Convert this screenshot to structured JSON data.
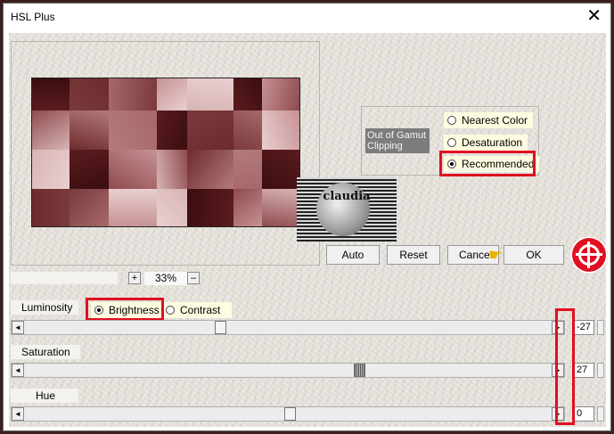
{
  "window": {
    "title": "HSL Plus",
    "close_glyph": "✕"
  },
  "preview": {
    "tile_colors": [
      "#5a1c1f",
      "#7a3a3c",
      "#a7686a",
      "#c69294",
      "#e9cfd0",
      "#3b0d0f",
      "#8f4b4e",
      "#d8b4b5",
      "#6e2a2d",
      "#b27a7c"
    ],
    "watermark_text": "claudia"
  },
  "gamut": {
    "label": "Out of Gamut Clipping",
    "options": [
      {
        "label": "Nearest Color",
        "selected": false
      },
      {
        "label": "Desaturation",
        "selected": false
      },
      {
        "label": "Recommended",
        "selected": true
      }
    ]
  },
  "buttons": {
    "auto": "Auto",
    "reset": "Reset",
    "cancel": "Cancel",
    "ok": "OK"
  },
  "zoom": {
    "plus": "+",
    "minus": "–",
    "value": "33%"
  },
  "luminosity": {
    "label": "Luminosity",
    "mode_options": [
      {
        "label": "Brightness",
        "selected": true
      },
      {
        "label": "Contrast",
        "selected": false
      }
    ],
    "value": "-27"
  },
  "saturation": {
    "label": "Saturation",
    "value": "27"
  },
  "hue": {
    "label": "Hue",
    "value": "0"
  },
  "slider_arrows": {
    "left": "◄",
    "right": "►"
  },
  "accent_colors": {
    "highlight_red": "#e01020",
    "radio_bg": "#fffbe0"
  }
}
